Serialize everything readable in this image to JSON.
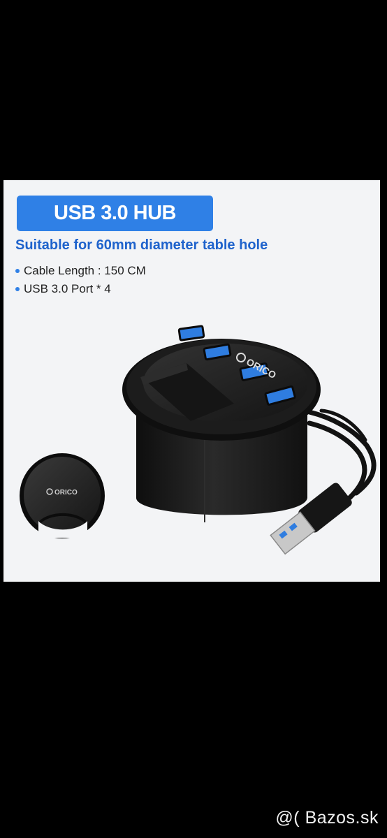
{
  "product": {
    "title": "USB 3.0 HUB",
    "subtitle": "Suitable for 60mm diameter table hole",
    "specs": [
      "Cable Length : 150 CM",
      "USB 3.0 Port * 4"
    ],
    "brand_logo": "ORICO",
    "colors": {
      "badge": "#2f80e6",
      "subtitle": "#1f63cc",
      "port": "#2f7de0",
      "body": "#1b1b1b"
    }
  },
  "watermark": "@( Bazos.sk"
}
